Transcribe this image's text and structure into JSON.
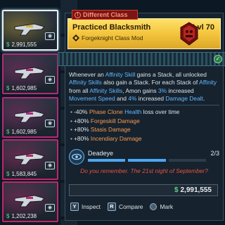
{
  "inventory": {
    "cards": [
      {
        "price": "2,991,555",
        "rarity_color": "#d9b32f",
        "selected": true,
        "icon": "eye-icon"
      },
      {
        "price": "1,602,985",
        "rarity_color": "#b02c7a",
        "icon": "download-icon"
      },
      {
        "price": "1,602,985",
        "rarity_color": "#b02c7a",
        "icon": "boost-icon"
      },
      {
        "price": "1,583,845",
        "rarity_color": "#c0256f",
        "icon": "eye-icon"
      },
      {
        "price": "1,202,238",
        "rarity_color": "#c0256f",
        "icon": "list-icon"
      }
    ]
  },
  "tooltip": {
    "banner": "Different Class",
    "name": "Practiced Blacksmith",
    "level": "Lvl 70",
    "subtitle": "Forgeknight Class Mod",
    "header_color": "#f2c23a",
    "description_parts": [
      {
        "t": "Whenever an ",
        "h": false
      },
      {
        "t": "Affinity Skill",
        "h": true
      },
      {
        "t": " gains a Stack, all unlocked ",
        "h": false
      },
      {
        "t": "Affinity Skills",
        "h": true
      },
      {
        "t": " also gain a Stack. For each Stack of ",
        "h": false
      },
      {
        "t": "Affinity",
        "h": true
      },
      {
        "t": " from all ",
        "h": false
      },
      {
        "t": "Affinity Skills",
        "h": true
      },
      {
        "t": ", Amon gains ",
        "h": false
      },
      {
        "t": "3%",
        "h": true
      },
      {
        "t": " increased ",
        "h": false
      },
      {
        "t": "Movement Speed",
        "h": true
      },
      {
        "t": " and ",
        "h": false
      },
      {
        "t": "4%",
        "h": true
      },
      {
        "t": " increased ",
        "h": false
      },
      {
        "t": "Damage Dealt",
        "h": true
      },
      {
        "t": ".",
        "h": false
      }
    ],
    "stats": [
      {
        "value": "-40%",
        "label": "Phase Clone",
        "label2": "Health",
        "rest": " loss over time"
      },
      {
        "value": "+80%",
        "label": "Forgeskill Damage"
      },
      {
        "value": "+80%",
        "label": "Stasis Damage"
      },
      {
        "value": "+80%",
        "label": "Incendiary Damage"
      }
    ],
    "skill": {
      "name": "Deadeye",
      "count": "2/3",
      "filled": 2,
      "total": 3
    },
    "quote": "Do you remember. The 21st night of September?",
    "price": "2,991,555",
    "actions": [
      {
        "key": "Y",
        "label": "Inspect"
      },
      {
        "key": "R",
        "label": "Compare"
      },
      {
        "key": "",
        "label": "Mark"
      }
    ]
  }
}
